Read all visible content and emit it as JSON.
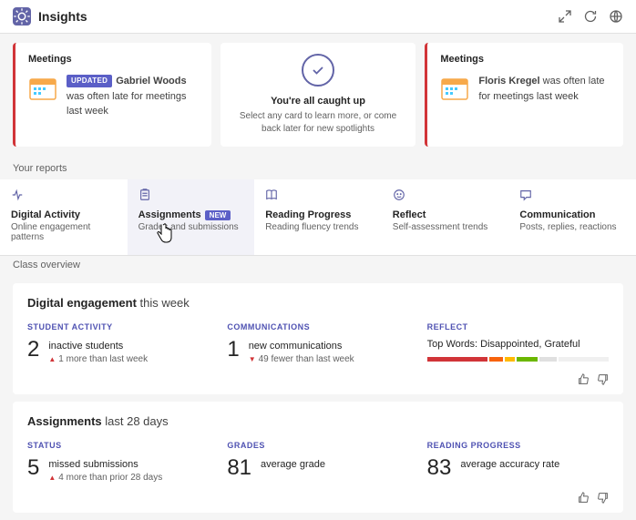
{
  "header": {
    "title": "Insights"
  },
  "spotlights": {
    "left": {
      "title": "Meetings",
      "badge": "UPDATED",
      "name": "Gabriel Woods",
      "rest": " was often late for meetings last week"
    },
    "center": {
      "title": "You're all caught up",
      "subtitle": "Select any card to learn more, or come back later for new spotlights"
    },
    "right": {
      "title": "Meetings",
      "name": "Floris Kregel",
      "rest": " was often late for meetings last week"
    }
  },
  "labels": {
    "your_reports": "Your reports",
    "class_overview": "Class overview"
  },
  "tabs": [
    {
      "title": "Digital Activity",
      "sub": "Online engagement patterns",
      "badge": ""
    },
    {
      "title": "Assignments",
      "sub": "Grades and submissions",
      "badge": "NEW"
    },
    {
      "title": "Reading Progress",
      "sub": "Reading fluency trends",
      "badge": ""
    },
    {
      "title": "Reflect",
      "sub": "Self-assessment trends",
      "badge": ""
    },
    {
      "title": "Communication",
      "sub": "Posts, replies, reactions",
      "badge": ""
    }
  ],
  "digital": {
    "title_bold": "Digital engagement",
    "title_rest": " this week",
    "activity": {
      "head": "STUDENT ACTIVITY",
      "num": "2",
      "desc": "inactive students",
      "trend": "1 more than last week"
    },
    "comms": {
      "head": "COMMUNICATIONS",
      "num": "1",
      "desc": "new communications",
      "trend": "49 fewer than last week"
    },
    "reflect": {
      "head": "REFLECT",
      "words": "Top Words: Disappointed, Grateful"
    }
  },
  "assignments": {
    "title_bold": "Assignments",
    "title_rest": " last 28 days",
    "status": {
      "head": "STATUS",
      "num": "5",
      "desc": "missed submissions",
      "trend": "4 more than prior 28 days"
    },
    "grades": {
      "head": "GRADES",
      "num": "81",
      "desc": "average grade"
    },
    "reading": {
      "head": "READING PROGRESS",
      "num": "83",
      "desc": "average accuracy rate"
    }
  },
  "reflect_bars": [
    {
      "w": 35,
      "c": "#d13438"
    },
    {
      "w": 8,
      "c": "#f7630c"
    },
    {
      "w": 6,
      "c": "#ffb900"
    },
    {
      "w": 12,
      "c": "#6bb700"
    },
    {
      "w": 10,
      "c": "#e0e0e0"
    },
    {
      "w": 29,
      "c": "#f0f0f0"
    }
  ]
}
